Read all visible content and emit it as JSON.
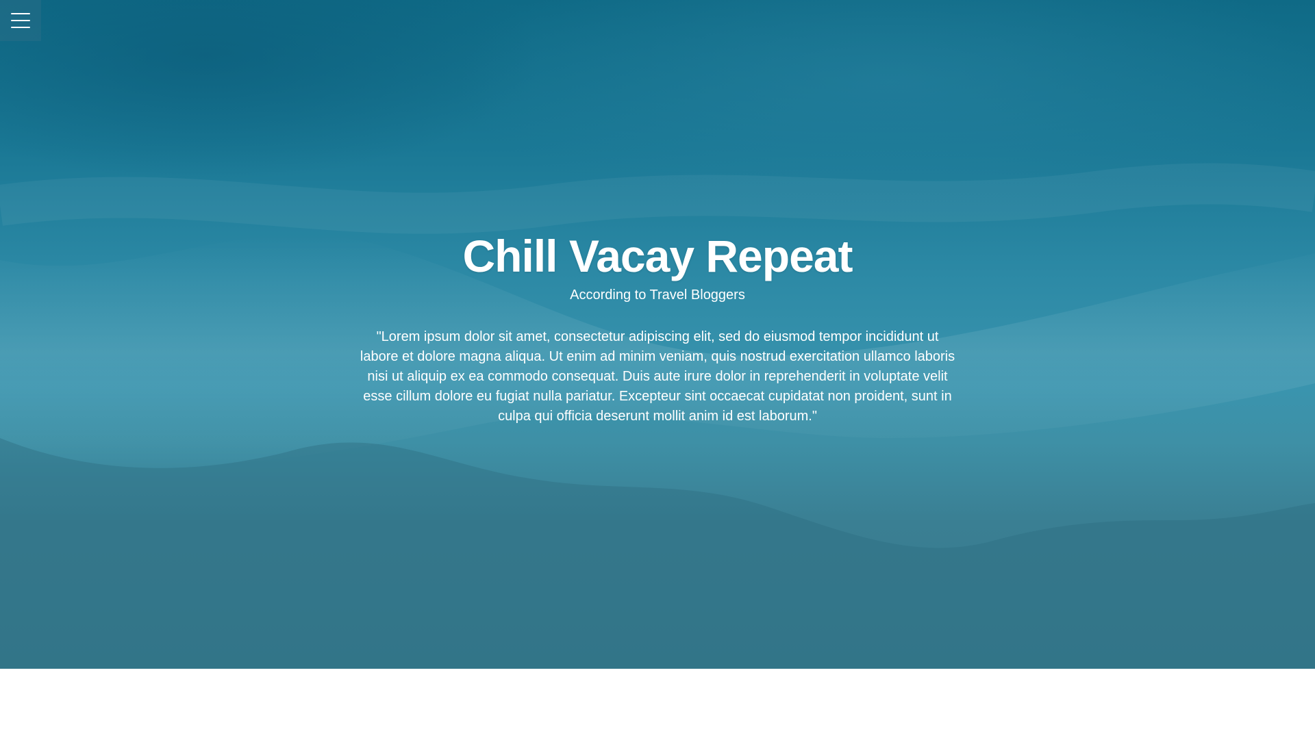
{
  "hero": {
    "title": "Chill Vacay Repeat",
    "subtitle": "According to Travel Bloggers",
    "quote": "\"Lorem ipsum dolor sit amet, consectetur adipiscing elit, sed do eiusmod tempor incididunt ut labore et dolore magna aliqua. Ut enim ad minim veniam, quis nostrud exercitation ullamco laboris nisi ut aliquip ex ea commodo consequat. Duis aute irure dolor in reprehenderit in voluptate velit esse cillum dolore eu fugiat nulla pariatur. Excepteur sint occaecat cupidatat non proident, sunt in culpa qui officia deserunt mollit anim id est laborum.\""
  },
  "nav": {
    "menu_icon": "hamburger-menu-icon"
  },
  "colors": {
    "overlay_top": "#0f6a86",
    "overlay_bottom": "#367a8d",
    "text": "#ffffff",
    "page_background": "#ffffff"
  }
}
